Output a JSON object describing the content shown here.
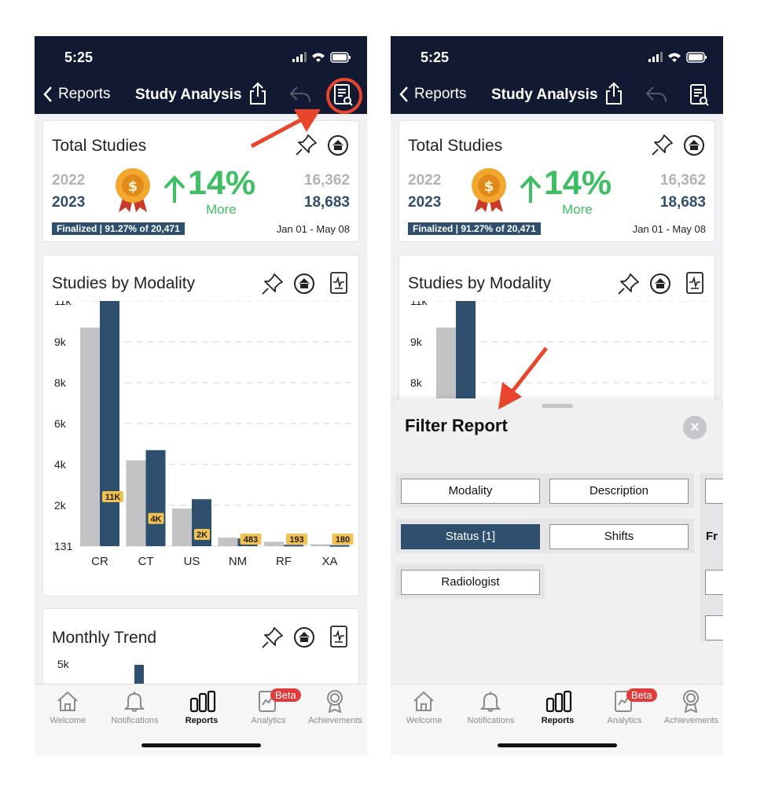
{
  "status_bar": {
    "time": "5:25"
  },
  "header": {
    "back_label": "Reports",
    "title": "Study Analysis"
  },
  "total_studies": {
    "title": "Total Studies",
    "prev_year": "2022",
    "curr_year": "2023",
    "prev_value": "16,362",
    "curr_value": "18,683",
    "change": "14%",
    "more": "More",
    "finalized": "Finalized | 91.27% of 20,471",
    "date_range": "Jan 01 - May 08"
  },
  "modality_card": {
    "title": "Studies by Modality"
  },
  "monthly_card": {
    "title": "Monthly Trend",
    "y_top_label": "5k"
  },
  "chart_data": {
    "type": "bar",
    "title": "Studies by Modality",
    "categories": [
      "CR",
      "CT",
      "US",
      "NM",
      "RF",
      "XA"
    ],
    "y_tick_labels": [
      "11k",
      "9k",
      "8k",
      "6k",
      "4k",
      "2k",
      "131"
    ],
    "ylim": [
      131,
      11000
    ],
    "grid": true,
    "series": [
      {
        "values": [
          9700,
          4200,
          1850,
          520,
          330,
          220
        ],
        "color": "#c3c3c5"
      },
      {
        "values": [
          11000,
          4700,
          2300,
          483,
          193,
          180
        ],
        "color": "#2f4f6f"
      }
    ],
    "data_labels": [
      "11K",
      "4K",
      "2K",
      "483",
      "193",
      "180"
    ],
    "label_color": "#f2c14e"
  },
  "tabs": [
    {
      "label": "Welcome",
      "icon": "home-icon"
    },
    {
      "label": "Notifications",
      "icon": "bell-icon"
    },
    {
      "label": "Reports",
      "icon": "bar-chart-icon"
    },
    {
      "label": "Analytics",
      "icon": "analytics-icon",
      "badge": "Beta"
    },
    {
      "label": "Achievements",
      "icon": "medal-icon"
    }
  ],
  "filter_sheet": {
    "title": "Filter Report",
    "chips": [
      "Modality",
      "Description",
      "Status [1]",
      "Shifts",
      "Radiologist"
    ],
    "partial_label": "Fr"
  },
  "colors": {
    "navy": "#121a33",
    "accent": "#2f4f6f",
    "green": "#3fbf64",
    "annotation_red": "#e8452c"
  }
}
